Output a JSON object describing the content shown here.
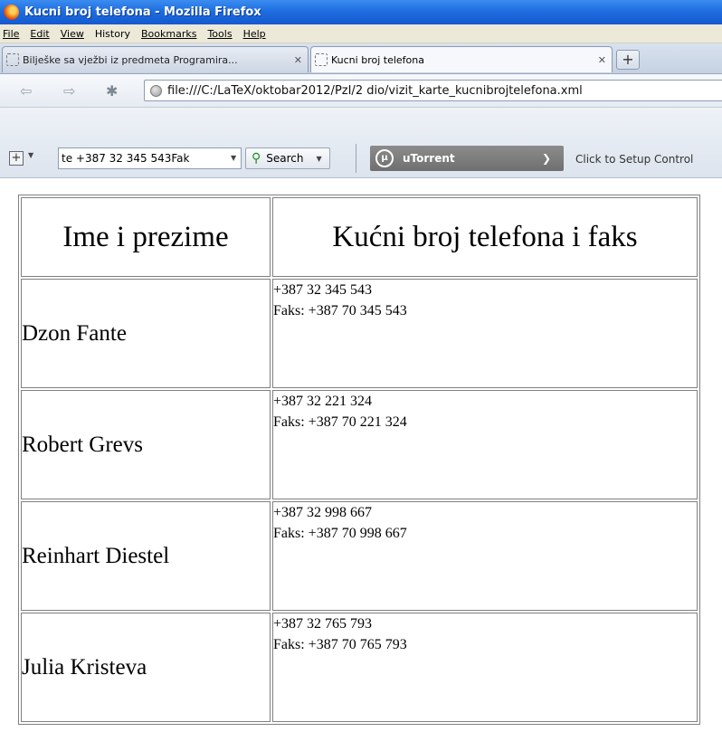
{
  "window": {
    "title": "Kucni broj telefona - Mozilla Firefox"
  },
  "menu": [
    "File",
    "Edit",
    "View",
    "History",
    "Bookmarks",
    "Tools",
    "Help"
  ],
  "tabs": [
    {
      "label": "Bilješke sa vježbi iz predmeta Programira...",
      "active": false
    },
    {
      "label": "Kucni broj telefona",
      "active": true
    }
  ],
  "new_tab_symbol": "+",
  "address_bar": {
    "url": "file:///C:/LaTeX/oktobar2012/PzI/2 dio/vizit_karte_kucnibrojtelefona.xml"
  },
  "search_toolbar": {
    "query": "te   +387 32 345 543Fak",
    "search_label": "Search"
  },
  "utorrent": {
    "label": "uTorrent",
    "setup_text": "Click to Setup Control"
  },
  "table": {
    "headers": [
      "Ime i prezime",
      "Kućni broj telefona i faks"
    ],
    "rows": [
      {
        "name": "Dzon Fante",
        "phone": "+387 32 345 543",
        "fax": "Faks: +387 70 345 543"
      },
      {
        "name": "Robert Grevs",
        "phone": "+387 32 221 324",
        "fax": "Faks: +387 70 221 324"
      },
      {
        "name": "Reinhart Diestel",
        "phone": "+387 32 998 667",
        "fax": "Faks: +387 70 998 667"
      },
      {
        "name": "Julia Kristeva",
        "phone": "+387 32 765 793",
        "fax": "Faks: +387 70 765 793"
      }
    ]
  },
  "icons": {
    "back": "back-arrow-icon",
    "forward": "forward-arrow-icon",
    "addons": "addons-icon",
    "site": "globe-icon",
    "search": "magnifier-icon",
    "close_tab": "close-icon"
  },
  "colors": {
    "titlebar": "#1e6ee0",
    "menubar": "#ece9d8",
    "border": "#808080",
    "search_icon": "#1f8c1f"
  }
}
